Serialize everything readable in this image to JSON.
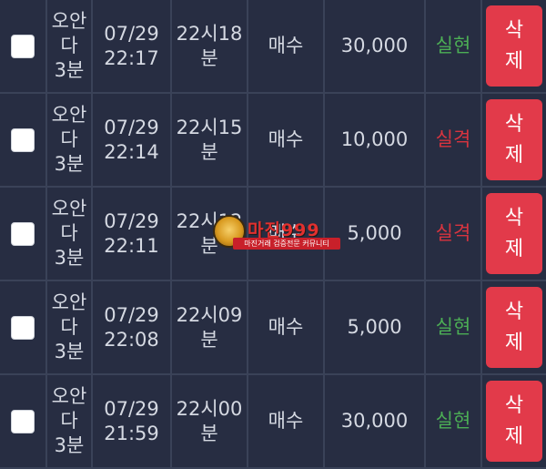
{
  "rows": [
    {
      "game": "오안\n다\n3분",
      "date": "07/29\n22:17",
      "round": "22시18\n분",
      "type": "매수",
      "amount": "30,000",
      "result": "실현",
      "delete_label": "삭\n제"
    },
    {
      "game": "오안\n다\n3분",
      "date": "07/29\n22:14",
      "round": "22시15\n분",
      "type": "매수",
      "amount": "10,000",
      "result": "실격",
      "delete_label": "삭\n제"
    },
    {
      "game": "오안\n다\n3분",
      "date": "07/29\n22:11",
      "round": "22시12\n분",
      "type": "매수",
      "amount": "5,000",
      "result": "실격",
      "delete_label": "삭\n제"
    },
    {
      "game": "오안\n다\n3분",
      "date": "07/29\n22:08",
      "round": "22시09\n분",
      "type": "매수",
      "amount": "5,000",
      "result": "실현",
      "delete_label": "삭\n제"
    },
    {
      "game": "오안\n다\n3분",
      "date": "07/29\n21:59",
      "round": "22시00\n분",
      "type": "매수",
      "amount": "30,000",
      "result": "실현",
      "delete_label": "삭\n제"
    }
  ],
  "watermark": {
    "title": "마진999",
    "subtitle": "마진거래 검증전문 커뮤니티",
    "icon": "eagle-emblem-icon"
  },
  "colors": {
    "background": "#272d42",
    "win": "#4cae55",
    "lose": "#d8343f",
    "delete_button": "#e23a4a"
  }
}
